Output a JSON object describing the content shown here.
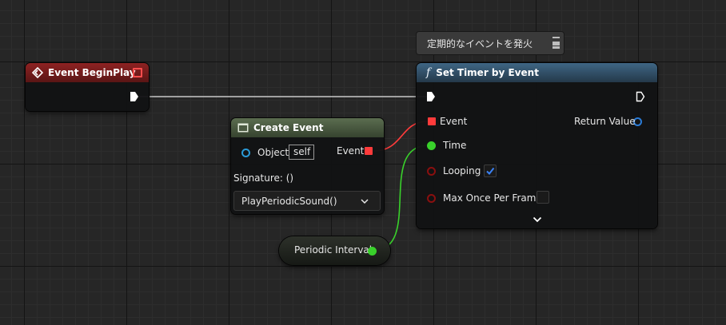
{
  "tooltip": {
    "text": "定期的なイベントを発火"
  },
  "begin_play": {
    "title": "Event BeginPlay"
  },
  "set_timer": {
    "title": "Set Timer by Event",
    "pins": {
      "event": "Event",
      "time": "Time",
      "looping": "Looping",
      "max_once": "Max Once Per Frame",
      "return_value": "Return Value"
    },
    "looping_checked": true,
    "max_once_checked": false
  },
  "create_event": {
    "title": "Create Event",
    "object_label": "Object",
    "object_value": "self",
    "event_label": "Event",
    "signature": "Signature: ()",
    "function_value": "PlayPeriodicSound()"
  },
  "variable": {
    "name": "Periodic Interval"
  },
  "colors": {
    "event_header": "#7f1d1d",
    "function_header": "#2f4a5e",
    "create_header": "#4b5a42",
    "delegate_pin": "#ff3b3b",
    "float_pin": "#39d12b",
    "bool_pin": "#8a0f0f",
    "object_pin": "#2a7bd6",
    "exec_wire": "#c8c8c8"
  }
}
